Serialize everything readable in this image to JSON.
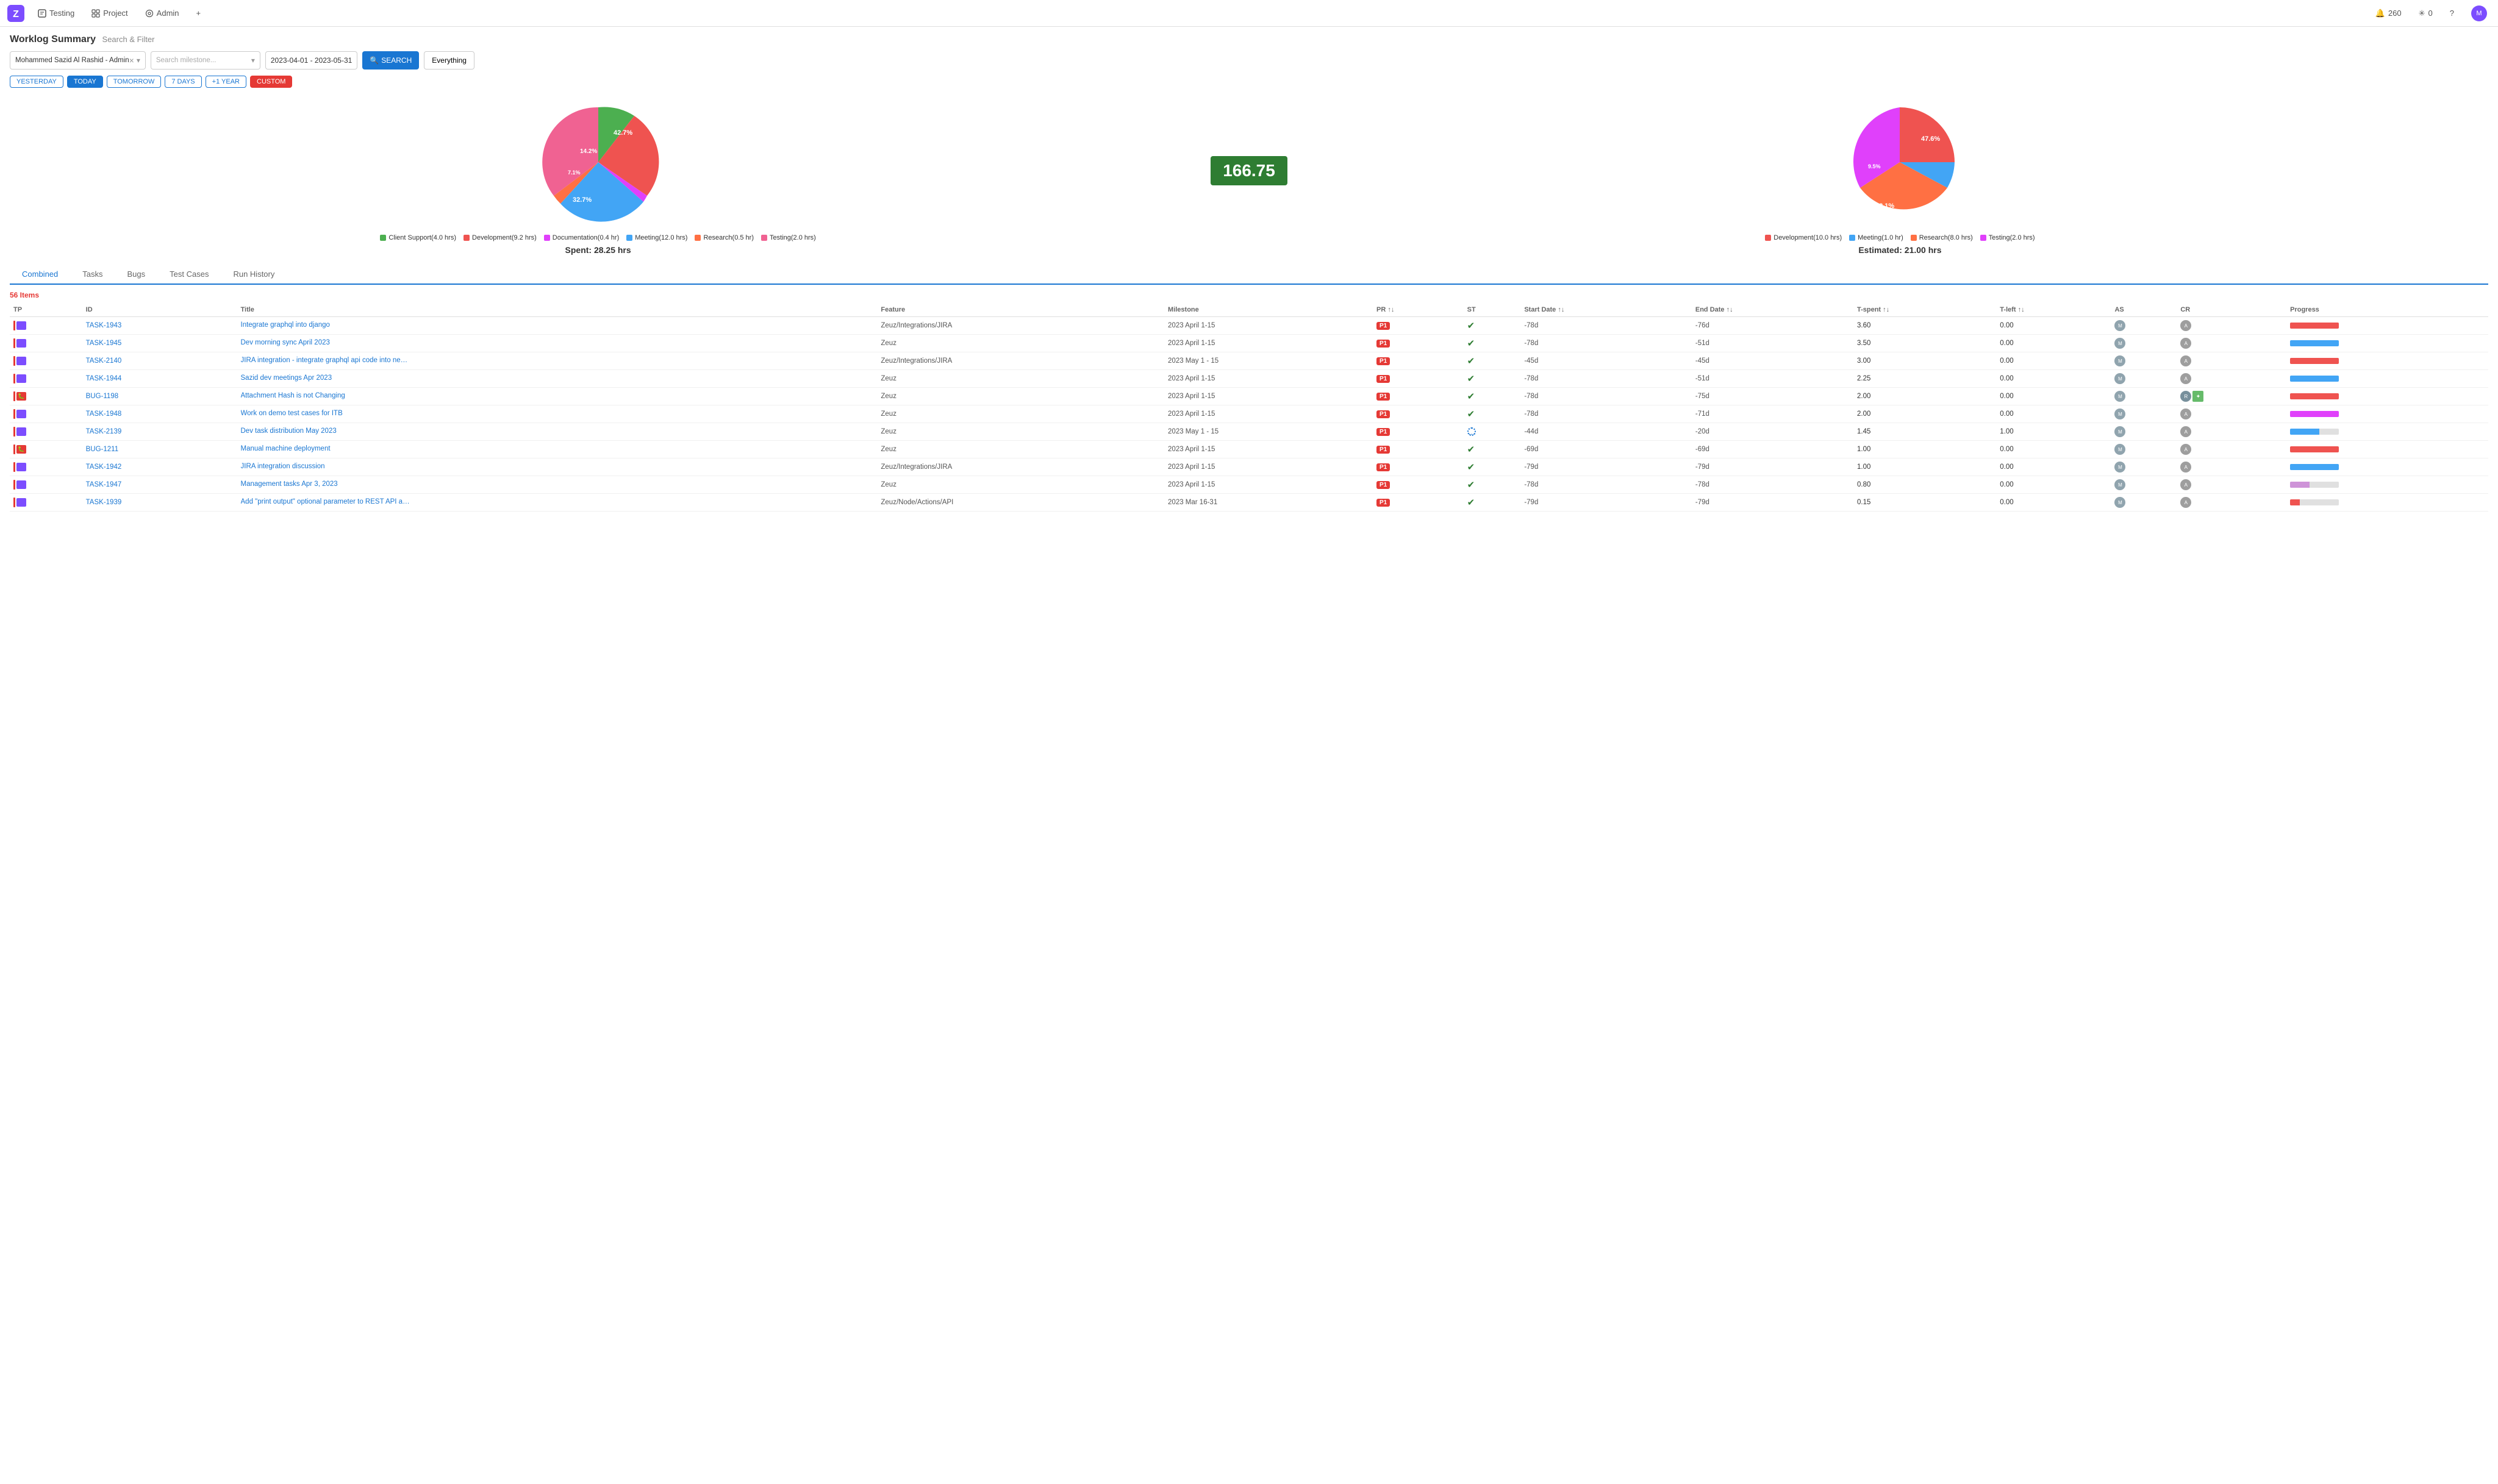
{
  "app": {
    "logo_text": "Z",
    "nav_items": [
      "Testing",
      "Project",
      "Admin"
    ],
    "nav_plus": "+",
    "notifications_count": "260",
    "connections_count": "0"
  },
  "page": {
    "title": "Worklog Summary",
    "subtitle": "Search & Filter"
  },
  "filters": {
    "user_value": "Mohammed Sazid Al Rashid - Admin",
    "milestone_placeholder": "Search milestone...",
    "date_range": "2023-04-01 - 2023-05-31",
    "search_label": "SEARCH",
    "everything_label": "Everything"
  },
  "date_buttons": [
    {
      "label": "YESTERDAY",
      "active": false
    },
    {
      "label": "TODAY",
      "active": true
    },
    {
      "label": "TOMORROW",
      "active": false
    },
    {
      "label": "7 DAYS",
      "active": false
    },
    {
      "label": "+1 YEAR",
      "active": false
    },
    {
      "label": "CUSTOM",
      "active": false,
      "special": "custom"
    }
  ],
  "chart_left": {
    "center_value": "166.75",
    "segments": [
      {
        "label": "Client Support(4.0 hrs)",
        "color": "#4caf50",
        "percent": 14.2,
        "startAngle": 0
      },
      {
        "label": "Development(9.2 hrs)",
        "color": "#ef5350",
        "percent": 32.7
      },
      {
        "label": "Documentation(0.4 hr)",
        "color": "#e040fb",
        "percent": 1.4
      },
      {
        "label": "Meeting(12.0 hrs)",
        "color": "#42a5f5",
        "percent": 42.7
      },
      {
        "label": "Research(0.5 hr)",
        "color": "#ff7043",
        "percent": 1.8
      },
      {
        "label": "Testing(2.0 hrs)",
        "color": "#f06292",
        "percent": 7.1
      }
    ],
    "spent_label": "Spent: 28.25 hrs"
  },
  "chart_right": {
    "segments": [
      {
        "label": "Development(10.0 hrs)",
        "color": "#ef5350",
        "percent": 47.6
      },
      {
        "label": "Meeting(1.0 hr)",
        "color": "#42a5f5",
        "percent": 4.8
      },
      {
        "label": "Research(8.0 hrs)",
        "color": "#ff7043",
        "percent": 38.1
      },
      {
        "label": "Testing(2.0 hrs)",
        "color": "#e040fb",
        "percent": 9.5
      }
    ],
    "estimated_label": "Estimated: 21.00 hrs"
  },
  "tabs": [
    "Combined",
    "Tasks",
    "Bugs",
    "Test Cases",
    "Run History"
  ],
  "active_tab": "Combined",
  "table": {
    "items_count": "56 Items",
    "columns": [
      "TP",
      "ID",
      "Title",
      "Feature",
      "Milestone",
      "PR ↑↓",
      "ST",
      "Start Date ↑↓",
      "End Date ↑↓",
      "T-spent ↑↓",
      "T-left ↑↓",
      "AS",
      "CR",
      "Progress"
    ],
    "rows": [
      {
        "tp": "task",
        "id": "TASK-1943",
        "title": "Integrate graphql into django",
        "feature": "Zeuz/Integrations/JIRA",
        "milestone": "2023 April 1-15",
        "pr": "P1",
        "st": "done",
        "start": "-78d",
        "end": "-76d",
        "tspent": "3.60",
        "tleft": "0.00",
        "progress": 100,
        "progress_color": "#ef5350"
      },
      {
        "tp": "task",
        "id": "TASK-1945",
        "title": "Dev morning sync April 2023",
        "feature": "Zeuz",
        "milestone": "2023 April 1-15",
        "pr": "P1",
        "st": "done",
        "start": "-78d",
        "end": "-51d",
        "tspent": "3.50",
        "tleft": "0.00",
        "progress": 100,
        "progress_color": "#42a5f5"
      },
      {
        "tp": "task",
        "id": "TASK-2140",
        "title": "JIRA integration - integrate graphql api code into new structure",
        "feature": "Zeuz/Integrations/JIRA",
        "milestone": "2023 May 1 - 15",
        "pr": "P1",
        "st": "done",
        "start": "-45d",
        "end": "-45d",
        "tspent": "3.00",
        "tleft": "0.00",
        "progress": 100,
        "progress_color": "#ef5350"
      },
      {
        "tp": "task",
        "id": "TASK-1944",
        "title": "Sazid dev meetings Apr 2023",
        "feature": "Zeuz",
        "milestone": "2023 April 1-15",
        "pr": "P1",
        "st": "done",
        "start": "-78d",
        "end": "-51d",
        "tspent": "2.25",
        "tleft": "0.00",
        "progress": 100,
        "progress_color": "#42a5f5"
      },
      {
        "tp": "bug",
        "id": "BUG-1198",
        "title": "Attachment Hash is not Changing",
        "feature": "Zeuz",
        "milestone": "2023 April 1-15",
        "pr": "P1",
        "st": "done",
        "start": "-78d",
        "end": "-75d",
        "tspent": "2.00",
        "tleft": "0.00",
        "progress": 100,
        "progress_color": "#ef5350"
      },
      {
        "tp": "task",
        "id": "TASK-1948",
        "title": "Work on demo test cases for ITB",
        "feature": "Zeuz",
        "milestone": "2023 April 1-15",
        "pr": "P1",
        "st": "done",
        "start": "-78d",
        "end": "-71d",
        "tspent": "2.00",
        "tleft": "0.00",
        "progress": 100,
        "progress_color": "#e040fb"
      },
      {
        "tp": "task",
        "id": "TASK-2139",
        "title": "Dev task distribution May 2023",
        "feature": "Zeuz",
        "milestone": "2023 May 1 - 15",
        "pr": "P1",
        "st": "inprogress",
        "start": "-44d",
        "end": "-20d",
        "tspent": "1.45",
        "tleft": "1.00",
        "progress": 60,
        "progress_color": "#42a5f5"
      },
      {
        "tp": "bug",
        "id": "BUG-1211",
        "title": "Manual machine deployment",
        "feature": "Zeuz",
        "milestone": "2023 April 1-15",
        "pr": "P1",
        "st": "done",
        "start": "-69d",
        "end": "-69d",
        "tspent": "1.00",
        "tleft": "0.00",
        "progress": 100,
        "progress_color": "#ef5350"
      },
      {
        "tp": "task",
        "id": "TASK-1942",
        "title": "JIRA integration discussion",
        "feature": "Zeuz/Integrations/JIRA",
        "milestone": "2023 April 1-15",
        "pr": "P1",
        "st": "done",
        "start": "-79d",
        "end": "-79d",
        "tspent": "1.00",
        "tleft": "0.00",
        "progress": 100,
        "progress_color": "#42a5f5"
      },
      {
        "tp": "task",
        "id": "TASK-1947",
        "title": "Management tasks Apr 3, 2023",
        "feature": "Zeuz",
        "milestone": "2023 April 1-15",
        "pr": "P1",
        "st": "done",
        "start": "-78d",
        "end": "-78d",
        "tspent": "0.80",
        "tleft": "0.00",
        "progress": 40,
        "progress_color": "#ce93d8"
      },
      {
        "tp": "task",
        "id": "TASK-1939",
        "title": "Add \"print output\" optional parameter to REST API actions",
        "feature": "Zeuz/Node/Actions/API",
        "milestone": "2023 Mar 16-31",
        "pr": "P1",
        "st": "done",
        "start": "-79d",
        "end": "-79d",
        "tspent": "0.15",
        "tleft": "0.00",
        "progress": 20,
        "progress_color": "#ef5350"
      }
    ]
  }
}
